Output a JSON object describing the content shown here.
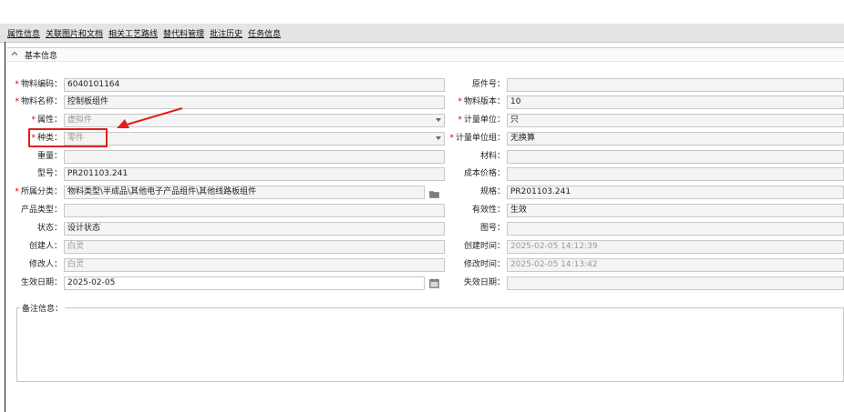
{
  "tabs": [
    "属性信息",
    "关联图片和文档",
    "相关工艺路线",
    "替代料管理",
    "批注历史",
    "任务信息"
  ],
  "section": {
    "title": "基本信息"
  },
  "left": [
    {
      "label": "物料编码：",
      "required": true,
      "value": "6040101164"
    },
    {
      "label": "物料名称：",
      "required": true,
      "value": "控制板组件"
    },
    {
      "label": "属性：",
      "required": true,
      "value": "虚拟件"
    },
    {
      "label": "种类：",
      "required": true,
      "value": "零件"
    },
    {
      "label": "重量：",
      "required": false,
      "value": ""
    },
    {
      "label": "型号：",
      "required": false,
      "value": "PR201103.241"
    },
    {
      "label": "所属分类：",
      "required": true,
      "value": "物料类型\\半成品\\其他电子产品组件\\其他线路板组件"
    },
    {
      "label": "产品类型：",
      "required": false,
      "value": ""
    },
    {
      "label": "状态：",
      "required": false,
      "value": "设计状态"
    },
    {
      "label": "创建人：",
      "required": false,
      "value": "白灵"
    },
    {
      "label": "修改人：",
      "required": false,
      "value": "白灵"
    },
    {
      "label": "生效日期：",
      "required": false,
      "value": "2025-02-05"
    }
  ],
  "right": [
    {
      "label": "原件号：",
      "required": false,
      "value": ""
    },
    {
      "label": "物料版本：",
      "required": true,
      "value": "10"
    },
    {
      "label": "计量单位：",
      "required": true,
      "value": "只"
    },
    {
      "label": "计量单位组：",
      "required": true,
      "value": "无换算"
    },
    {
      "label": "材料：",
      "required": false,
      "value": ""
    },
    {
      "label": "成本价格：",
      "required": false,
      "value": ""
    },
    {
      "label": "规格：",
      "required": false,
      "value": "PR201103.241"
    },
    {
      "label": "有效性：",
      "required": false,
      "value": "生效"
    },
    {
      "label": "图号：",
      "required": false,
      "value": ""
    },
    {
      "label": "创建时间：",
      "required": false,
      "value": "2025-02-05 14:12:39"
    },
    {
      "label": "修改时间：",
      "required": false,
      "value": "2025-02-05 14:13:42"
    },
    {
      "label": "失效日期：",
      "required": false,
      "value": ""
    }
  ],
  "remarks": {
    "label": "备注信息："
  },
  "colors": {
    "required": "#d40000",
    "highlight": "#e01f1f"
  }
}
